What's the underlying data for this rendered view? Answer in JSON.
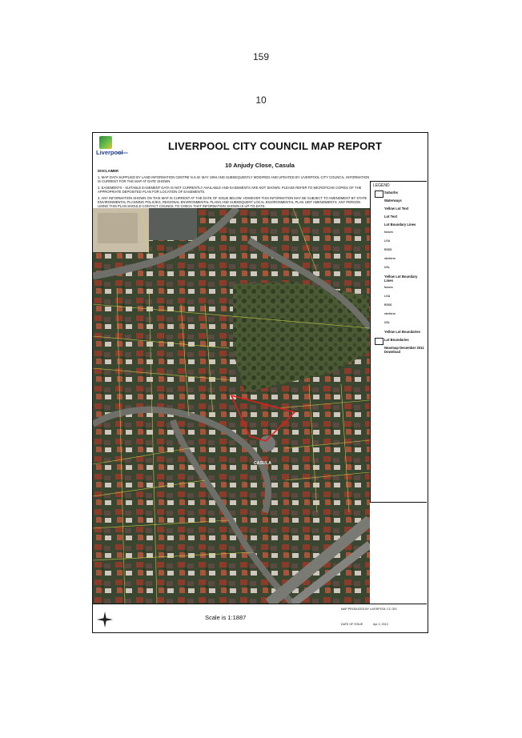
{
  "page_numbers": [
    "159",
    "10"
  ],
  "report": {
    "title": "LIVERPOOL CITY COUNCIL MAP REPORT",
    "logo_text": "Liverpool",
    "logo_subtext": "Australia",
    "address": "10 Anjudy Close, Casula",
    "disclaimer_title": "DISCLAIMER",
    "disclaimer": [
      "1. MAP DATA SUPPLIED BY LAND INFORMATION CENTRE N.S.W. MAY 1994 AND SUBSEQUENTLY MODIFIED AND UPDATED BY LIVERPOOL CITY COUNCIL. INFORMATION IS CURRENT FOR THE MAP AT DATE SHOWN.",
      "2. EASEMENTS - SUITABLE EASEMENT DATA IS NOT CURRENTLY AVAILABLE AND EASEMENTS ARE NOT SHOWN. PLEASE REFER TO MICROFICHE COPIES OF THE APPROPRIATE DEPOSITED PLAN FOR LOCATION OF EASEMENTS.",
      "3. ANY INFORMATION SHOWN ON THIS MAP IS CURRENT AT THE DATE OF ISSUE BELOW. HOWEVER THIS INFORMATION MAY BE SUBJECT TO AMENDMENT BY STATE ENVIRONMENTAL PLANNING POLICIES, REGIONAL ENVIRONMENTAL PLANS AND SUBSEQUENT LOCAL ENVIRONMENTAL PLAN 1997 AMENDMENTS. ANY PERSON USING THIS PLAN SHOULD CONTACT COUNCIL TO CHECK THAT INFORMATION SHOWN IS UP-TO-DATE."
    ],
    "map_label": "CASULA",
    "scale": "Scale is 1:1887",
    "produced_by": "MAP PRODUCED BY LIVERPOOL CC GIS",
    "date_of_issue_label": "DATE OF ISSUE",
    "date_of_issue": "Apr 2, 2013"
  },
  "legend": {
    "title": "LEGEND",
    "items": [
      {
        "label": "Suburbs",
        "kind": "box"
      },
      {
        "label": "Waterways",
        "kind": "none"
      },
      {
        "label": "Yellow Lot Text",
        "kind": "none"
      },
      {
        "label": "Lot Text",
        "kind": "none"
      },
      {
        "label": "Lot Boundary Lines",
        "kind": "none"
      },
      {
        "label": "fosses",
        "kind": "sub"
      },
      {
        "label": "LGA",
        "kind": "sub"
      },
      {
        "label": "RDSS",
        "kind": "sub"
      },
      {
        "label": "streform",
        "kind": "sub"
      },
      {
        "label": "USL",
        "kind": "sub"
      },
      {
        "label": "Yellow Lot Boundary Lines",
        "kind": "none"
      },
      {
        "label": "fosses",
        "kind": "sub"
      },
      {
        "label": "LGA",
        "kind": "sub"
      },
      {
        "label": "RDSS",
        "kind": "sub"
      },
      {
        "label": "streform",
        "kind": "sub"
      },
      {
        "label": "USL",
        "kind": "sub"
      },
      {
        "label": "Yellow Lot Boundaries",
        "kind": "none"
      },
      {
        "label": "Lot Boundaries",
        "kind": "box"
      },
      {
        "label": "Nearmap December 2011 Download",
        "kind": "none"
      }
    ]
  },
  "colors": {
    "lot_boundary": "#d9d94a",
    "subject_lot": "#e01e1e",
    "road": "#6f6f6a",
    "vegetation": "#3f5a2e"
  }
}
